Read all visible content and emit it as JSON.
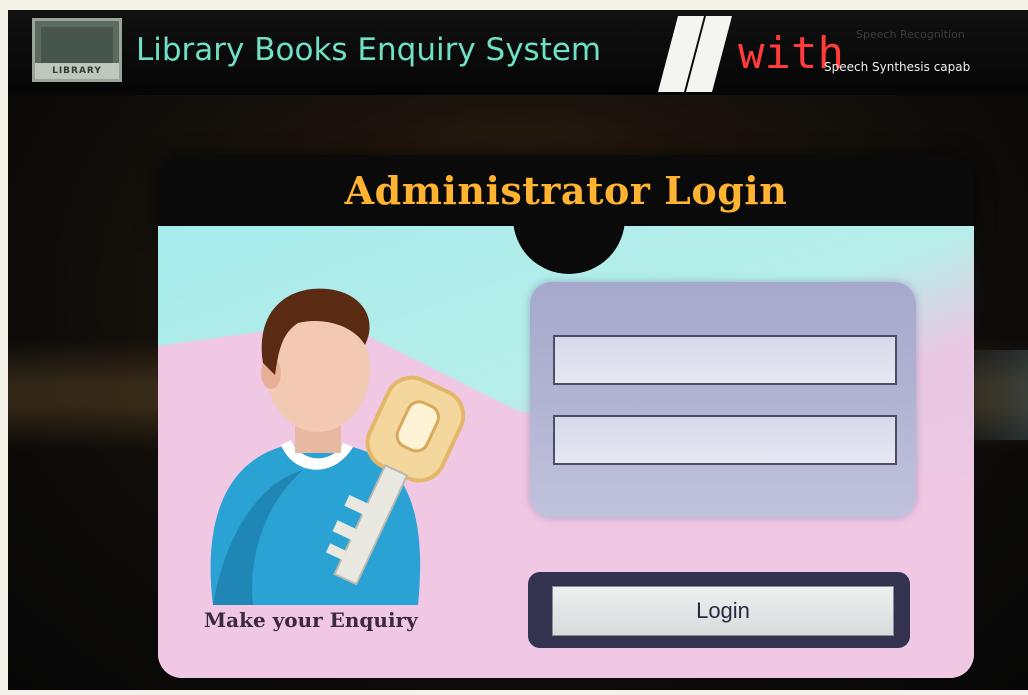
{
  "header": {
    "logo_text": "LIBRARY",
    "title": "Library Books Enquiry System",
    "with_text": "with",
    "speech_recognition_text": "Speech Recognition",
    "speech_synthesis_text": "Speech Synthesis capab"
  },
  "login_panel": {
    "title": "Administrator Login",
    "username_value": "",
    "password_value": "",
    "login_button_label": "Login",
    "enquiry_link_label": "Make your Enquiry"
  },
  "colors": {
    "title_teal": "#6fe0c6",
    "with_red": "#ff3b3b",
    "panel_title_orange": "#ffb330",
    "panel_teal": "#a7ecec",
    "panel_pink": "#f1c9e6",
    "form_lavender": "#a6a8cd",
    "login_frame": "#34334f"
  },
  "icons": {
    "avatar": "admin-user-with-key-icon",
    "logo": "library-logo-icon",
    "divider": "double-slash-icon"
  }
}
